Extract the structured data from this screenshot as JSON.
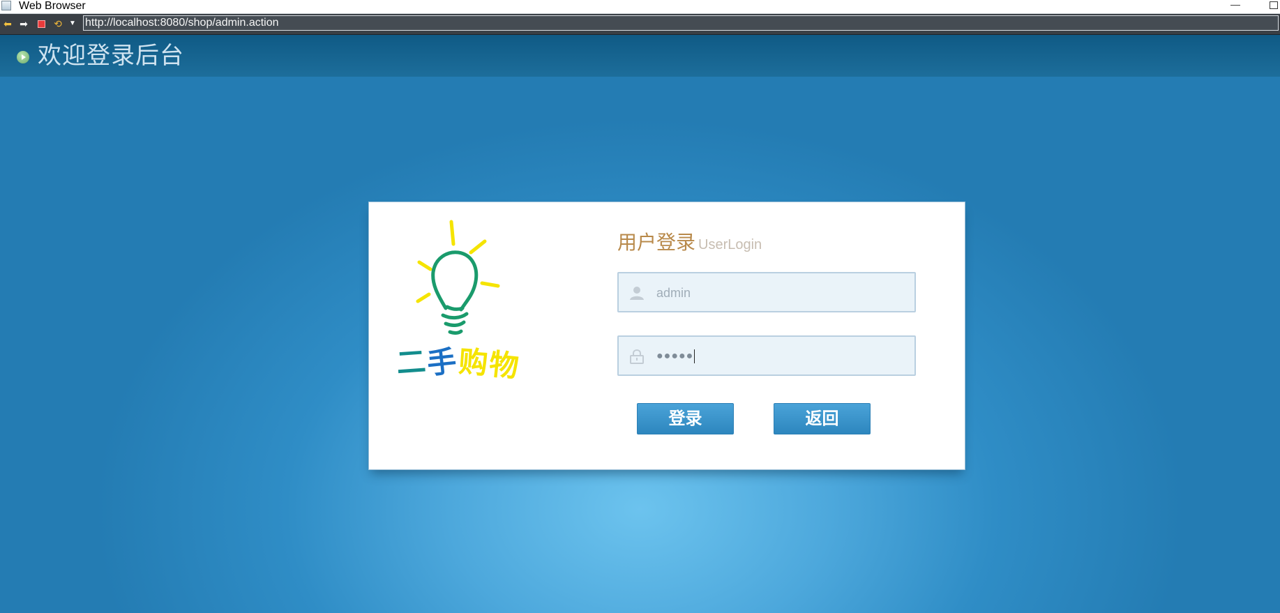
{
  "window": {
    "title": "Web Browser",
    "minimize_glyph": "—"
  },
  "toolbar": {
    "url": "http://localhost:8080/shop/admin.action",
    "icons": [
      "back-arrow-icon",
      "forward-arrow-icon",
      "stop-icon",
      "refresh-icon",
      "dropdown-icon"
    ]
  },
  "header": {
    "title": "欢迎登录后台"
  },
  "login": {
    "title": "用户登录",
    "subtitle": "UserLogin",
    "logo_text": [
      "二",
      "手",
      "购",
      "物"
    ],
    "username_value": "admin",
    "password_mask": "●●●●●",
    "login_button": "登录",
    "back_button": "返回"
  },
  "colors": {
    "header_bg": "#175f8a",
    "title_accent": "#b8894a",
    "button_bg": "#3a95cc",
    "logo_green": "#1a9b6c",
    "logo_yellow": "#f5e400",
    "logo_blue": "#1b6fc4",
    "logo_teal": "#138d8d"
  }
}
